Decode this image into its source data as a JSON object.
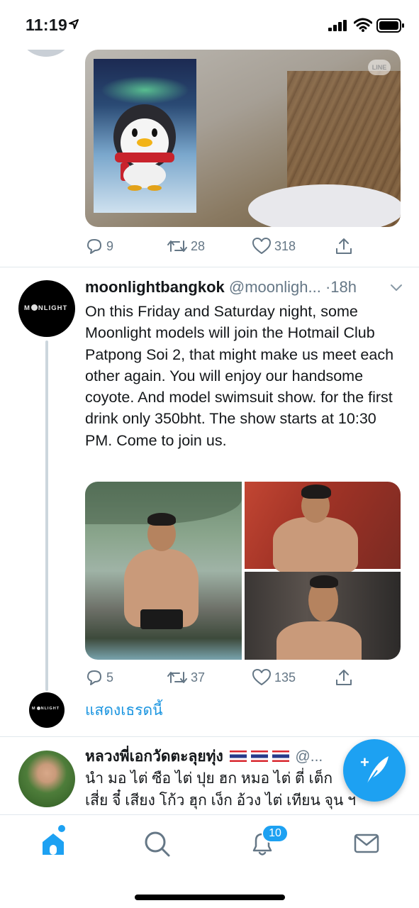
{
  "status_bar": {
    "time": "11:19"
  },
  "tweet_prev": {
    "image_badge": "LINE",
    "replies": "9",
    "retweets": "28",
    "likes": "318"
  },
  "tweet_main": {
    "display_name": "moonlightbangkok",
    "handle": "@moonligh...",
    "time": "·18h",
    "avatar_text": "MOONLIGHT",
    "text": "On this Friday and Saturday night, some Moonlight models will join the Hotmail Club Patpong Soi 2, that might make us meet each other again. You will enjoy our handsome coyote. And model swimsuit show. for the first drink only 350bht. The show starts at 10:30 PM. Come to join us.",
    "replies": "5",
    "retweets": "37",
    "likes": "135"
  },
  "thread": {
    "show_thread_label": "แสดงเธรดนี้"
  },
  "tweet_next": {
    "display_name": "หลวงพี่เอกวัดตะลุยทุ่ง",
    "handle": "@...",
    "line1": "นำ มอ ไต่ ซือ ไต่ ปุย ฮก หมอ ไต่ ตี่ เต็ก",
    "line2": "เสี่ย จี๋ เสียง โก้ว ฮุก เง็ก อ้วง ไต่ เทียน จุน ฯ"
  },
  "tab_bar": {
    "notification_count": "10"
  },
  "colors": {
    "accent": "#1da1f2",
    "link": "#1b95e0",
    "secondary_text": "#657786",
    "divider": "#e1e8ed"
  }
}
